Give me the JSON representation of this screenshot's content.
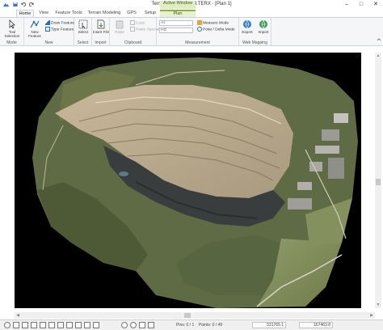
{
  "window": {
    "title": "Terrain - Background.TERX - [Plan 1]",
    "context_tab_group": "Active Window",
    "controls": {
      "minimize": "–",
      "maximize": "□",
      "close": "✕"
    }
  },
  "tabs": [
    {
      "label": "Home",
      "active": true
    },
    {
      "label": "View",
      "active": false
    },
    {
      "label": "Feature Tools",
      "active": false
    },
    {
      "label": "Terrain Modeling",
      "active": false
    },
    {
      "label": "GPS",
      "active": false
    },
    {
      "label": "Setup",
      "active": false
    },
    {
      "label": "Plan",
      "active": false
    }
  ],
  "ribbon": {
    "mode": {
      "label": "Mode",
      "tool_selection": "Tool Selection"
    },
    "new": {
      "label": "New",
      "new_feature": "New Feature",
      "draw_feature": "Draw Feature",
      "type_feature": "Type Feature"
    },
    "select": {
      "label": "Select",
      "select": "Select"
    },
    "import": {
      "label": "Import",
      "insert_file": "Insert File"
    },
    "clipboard": {
      "label": "Clipboard",
      "paste": "Paste",
      "copy": "Copy",
      "paste_special": "Paste Special"
    },
    "measurement": {
      "label": "Measurement",
      "az_placeholder": "Az",
      "hd_placeholder": "HD",
      "measure_mode": "Measure Mode",
      "polar_delta_mode": "Polar / Delta Mode"
    },
    "web_mapping": {
      "label": "Web Mapping",
      "export": "Export",
      "import": "Import"
    }
  },
  "status": {
    "pins": "Pins: 0 / 1",
    "points": "Points: 0 / 49",
    "easting": "531765.1",
    "northing": "167463.8"
  },
  "colors": {
    "ribbon_bg": "#f5f6f7",
    "context_tab": "#e7f0d0",
    "viewport_bg": "#000000"
  },
  "icons": [
    "app-icon",
    "save-icon",
    "undo-icon",
    "redo-icon",
    "cursor-icon",
    "draw-icon",
    "select-icon",
    "insert-file-icon",
    "paste-icon",
    "copy-icon",
    "measure-icon",
    "polar-icon",
    "export-icon",
    "import-icon",
    "zoom-in-icon",
    "zoom-out-icon",
    "pan-icon",
    "grid-icon"
  ]
}
